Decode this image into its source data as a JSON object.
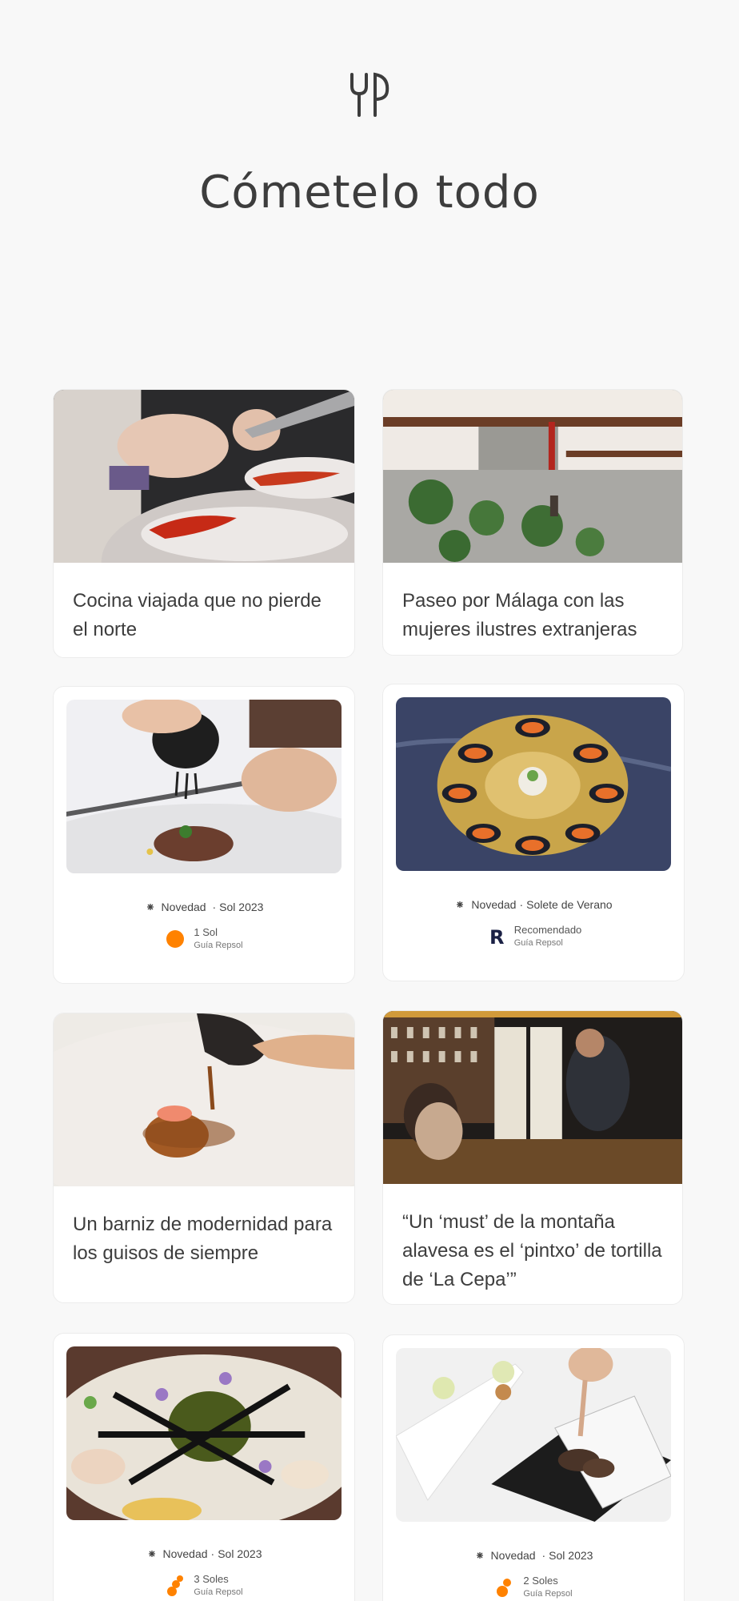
{
  "header": {
    "title": "Cómetelo todo",
    "logo_icon": "fork-knife-logo-icon"
  },
  "cards": [
    {
      "type": "article",
      "title": "Cocina viajada que no pierde el norte",
      "image": "chef-plating-red-prawns"
    },
    {
      "type": "article",
      "title": "Paseo por Málaga con las mujeres ilustres extranjeras",
      "image": "courtyard-with-balconies-and-plants"
    },
    {
      "type": "restaurant",
      "tag": "Novedad",
      "award": "Sol 2023",
      "rating_name": "1 Sol",
      "rating_source": "Guía Repsol",
      "rating_icon": "sun-1-icon",
      "image": "truffle-grated-over-dish"
    },
    {
      "type": "restaurant",
      "tag": "Novedad",
      "award": "Solete de Verano",
      "rating_name": "Recomendado",
      "rating_source": "Guía Repsol",
      "rating_icon": "repsol-r-icon",
      "image": "mussels-golden-plate"
    },
    {
      "type": "article",
      "title": "Un barniz de modernidad para los guisos de siempre",
      "image": "sauce-poured-on-dish"
    },
    {
      "type": "article",
      "title": "“Un ‘must’ de la montaña alavesa es el ‘pintxo’ de tortilla de ‘La Cepa’”",
      "image": "bar-counter-with-diners"
    },
    {
      "type": "restaurant",
      "tag": "Novedad",
      "award": "Sol 2023",
      "rating_name": "3 Soles",
      "rating_source": "Guía Repsol",
      "rating_icon": "sun-3-icon",
      "image": "green-sphere-dish"
    },
    {
      "type": "restaurant",
      "tag": "Novedad",
      "award": "Sol 2023",
      "rating_name": "2 Soles",
      "rating_source": "Guía Repsol",
      "rating_icon": "sun-2-icon",
      "image": "snacks-and-menu-paper"
    }
  ],
  "colors": {
    "background": "#f8f8f8",
    "sun_orange": "#ff8200",
    "repsol_navy": "#1b2145",
    "text": "#3d3d3d"
  }
}
